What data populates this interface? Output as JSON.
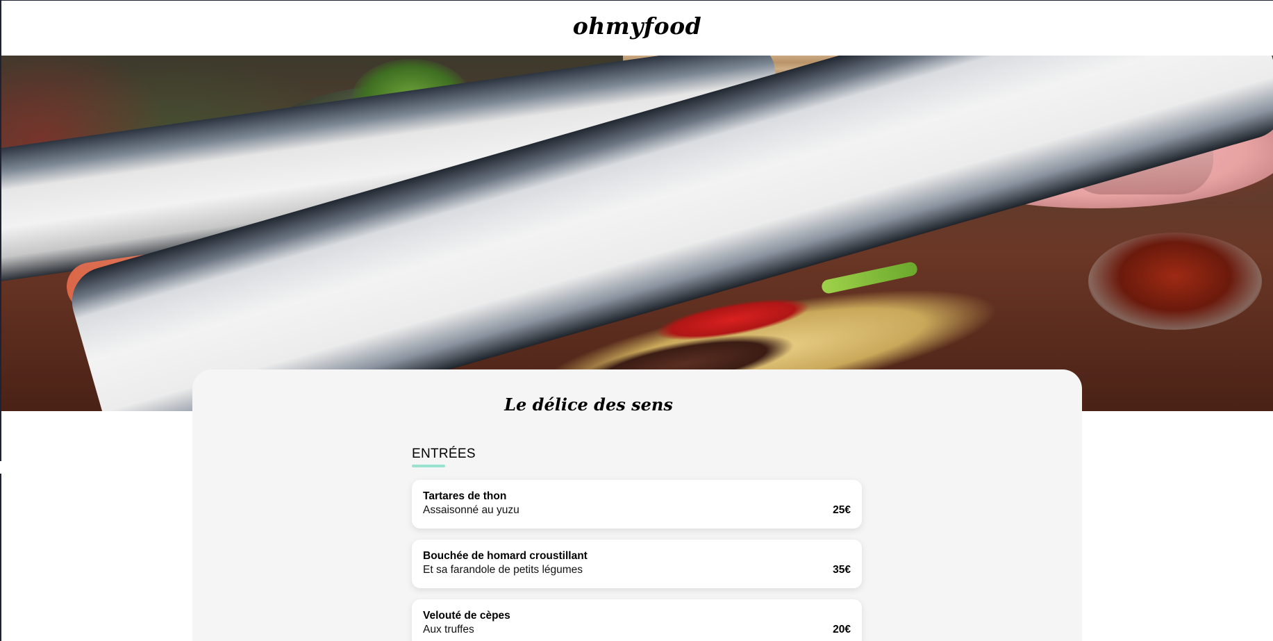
{
  "header": {
    "logo": "ohmyfood"
  },
  "restaurant": {
    "title": "Le délice des sens"
  },
  "menu": {
    "section_title": "ENTRÉES",
    "accent_color": "#99e2d0",
    "dishes": [
      {
        "name": "Tartares de thon",
        "description": "Assaisonné au yuzu",
        "price": "25€"
      },
      {
        "name": "Bouchée de homard croustillant",
        "description": "Et sa farandole de petits légumes",
        "price": "35€"
      },
      {
        "name": "Velouté de cèpes",
        "description": "Aux truffes",
        "price": "20€"
      }
    ]
  }
}
